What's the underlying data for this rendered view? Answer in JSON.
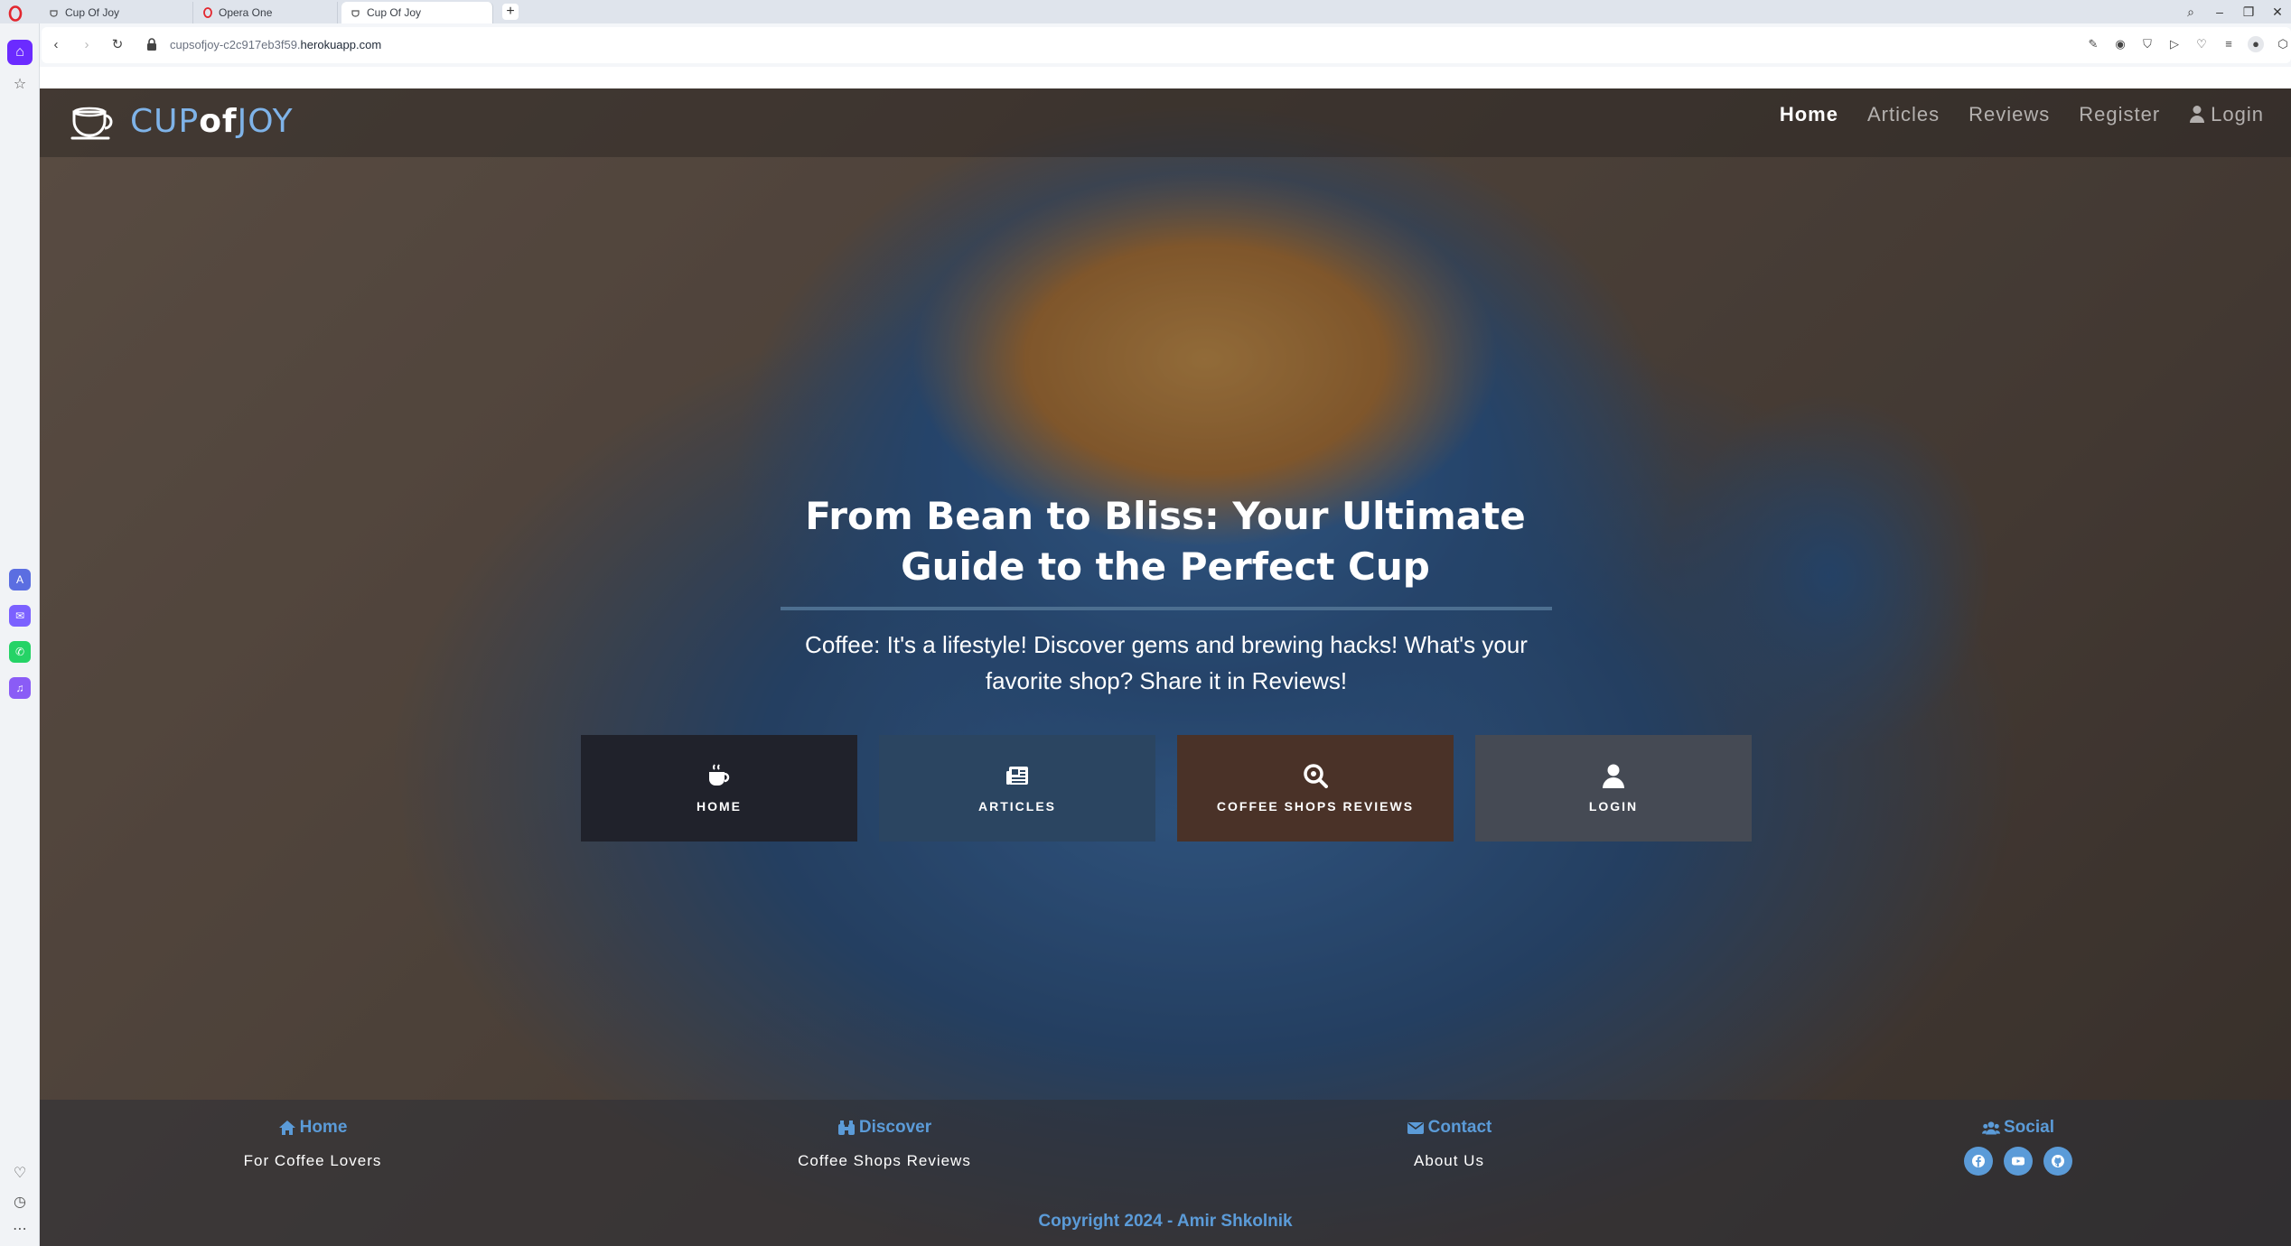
{
  "browser": {
    "tabs": [
      {
        "label": "Cup Of Joy",
        "active": false
      },
      {
        "label": "Opera One",
        "active": false
      },
      {
        "label": "Cup Of Joy",
        "active": true
      }
    ],
    "new_tab": "+",
    "url_prefix": "cupsofjoy-c2c917eb3f59.",
    "url_domain": "herokuapp.com",
    "accent": "#6b2bff"
  },
  "site": {
    "brand": {
      "cup": "CUP",
      "of": "of",
      "joy": "JOY"
    },
    "nav": {
      "home": "Home",
      "articles": "Articles",
      "reviews": "Reviews",
      "register": "Register",
      "login": "Login"
    },
    "hero": {
      "title": "From Bean to Bliss: Your Ultimate Guide to the Perfect Cup",
      "subtitle": "Coffee: It's a lifestyle! Discover gems and brewing hacks! What's your favorite shop? Share it in Reviews!"
    },
    "cards": {
      "home": "HOME",
      "articles": "ARTICLES",
      "reviews": "COFFEE SHOPS REVIEWS",
      "login": "LOGIN"
    },
    "footer": {
      "home": {
        "heading": "Home",
        "text": "For Coffee Lovers"
      },
      "discover": {
        "heading": "Discover",
        "text": "Coffee Shops Reviews"
      },
      "contact": {
        "heading": "Contact",
        "text": "About Us"
      },
      "social": {
        "heading": "Social"
      },
      "copyright": "Copyright 2024 - Amir Shkolnik"
    },
    "colors": {
      "accent": "#5b9bd8",
      "brand_blue": "#7fb3e8"
    }
  }
}
